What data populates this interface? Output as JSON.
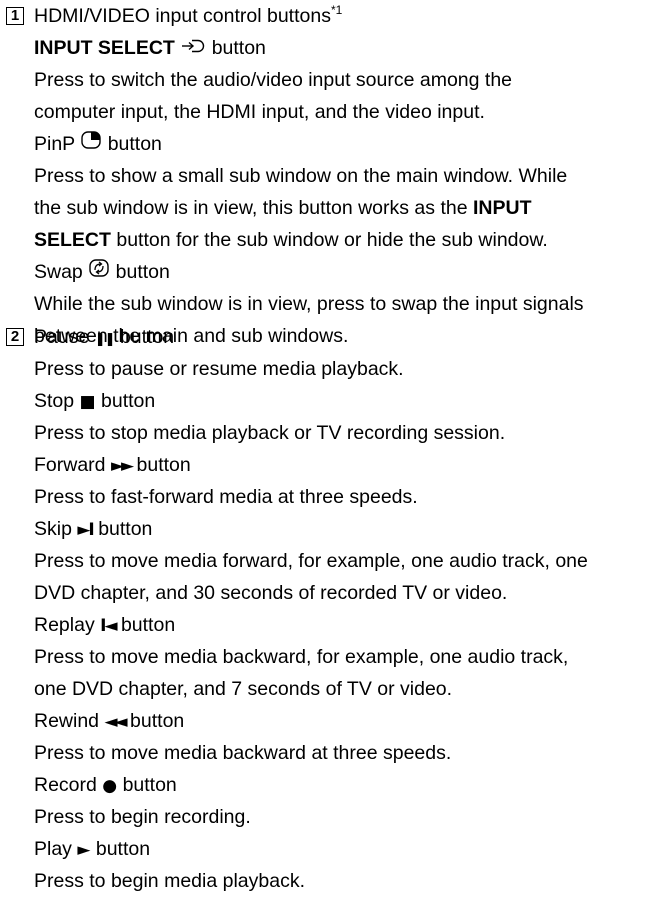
{
  "section1": {
    "number": "1",
    "heading": "HDMI/VIDEO input control buttons",
    "footnote_mark": "*1",
    "input_select": {
      "label": "INPUT SELECT",
      "icon": "input-select-icon",
      "suffix": "button",
      "desc": [
        "Press to switch the audio/video input source among the",
        "computer input, the HDMI input, and the video input."
      ]
    },
    "pinp": {
      "label": "PinP",
      "icon": "pinp-icon",
      "suffix": "button",
      "desc_line1": "Press to show a small sub window on the main window. While",
      "desc_line2_pre": "the sub window is in view, this button works as the",
      "desc_line2_bold": "INPUT",
      "desc_line3_bold": "SELECT",
      "desc_line3_post": "button for the sub window or hide the sub window."
    },
    "swap": {
      "label": "Swap",
      "icon": "swap-icon",
      "suffix": "button",
      "desc": [
        "While the sub window is in view, press to swap the input signals",
        "between the main and sub windows."
      ]
    }
  },
  "section2": {
    "number": "2",
    "buttons": [
      {
        "label": "Pause",
        "glyph": "❚❚",
        "icon": "pause-icon",
        "suffix": "button",
        "desc": [
          "Press to pause or resume media playback."
        ]
      },
      {
        "label": "Stop",
        "glyph": "■",
        "icon": "stop-icon",
        "suffix": "button",
        "desc": [
          "Press to stop media playback or TV recording session."
        ]
      },
      {
        "label": "Forward",
        "glyph": "►►",
        "icon": "forward-icon",
        "suffix": "button",
        "desc": [
          "Press to fast-forward media at three speeds."
        ]
      },
      {
        "label": "Skip",
        "glyph": "►I",
        "icon": "skip-icon",
        "suffix": "button",
        "desc": [
          "Press to move media forward, for example, one audio track, one",
          "DVD chapter, and 30 seconds of recorded TV or video."
        ]
      },
      {
        "label": "Replay",
        "glyph": "I◄",
        "icon": "replay-icon",
        "suffix": "button",
        "desc": [
          "Press to move media backward, for example, one audio track,",
          "one DVD chapter, and 7 seconds of TV or video."
        ]
      },
      {
        "label": "Rewind",
        "glyph": "◄◄",
        "icon": "rewind-icon",
        "suffix": "button",
        "desc": [
          "Press to move media backward at three speeds."
        ]
      },
      {
        "label": "Record",
        "glyph": "●",
        "icon": "record-icon",
        "suffix": "button",
        "desc": [
          "Press to begin recording."
        ]
      },
      {
        "label": "Play",
        "glyph": "►",
        "icon": "play-icon",
        "suffix": "button",
        "desc": [
          "Press to begin media playback."
        ]
      }
    ]
  }
}
